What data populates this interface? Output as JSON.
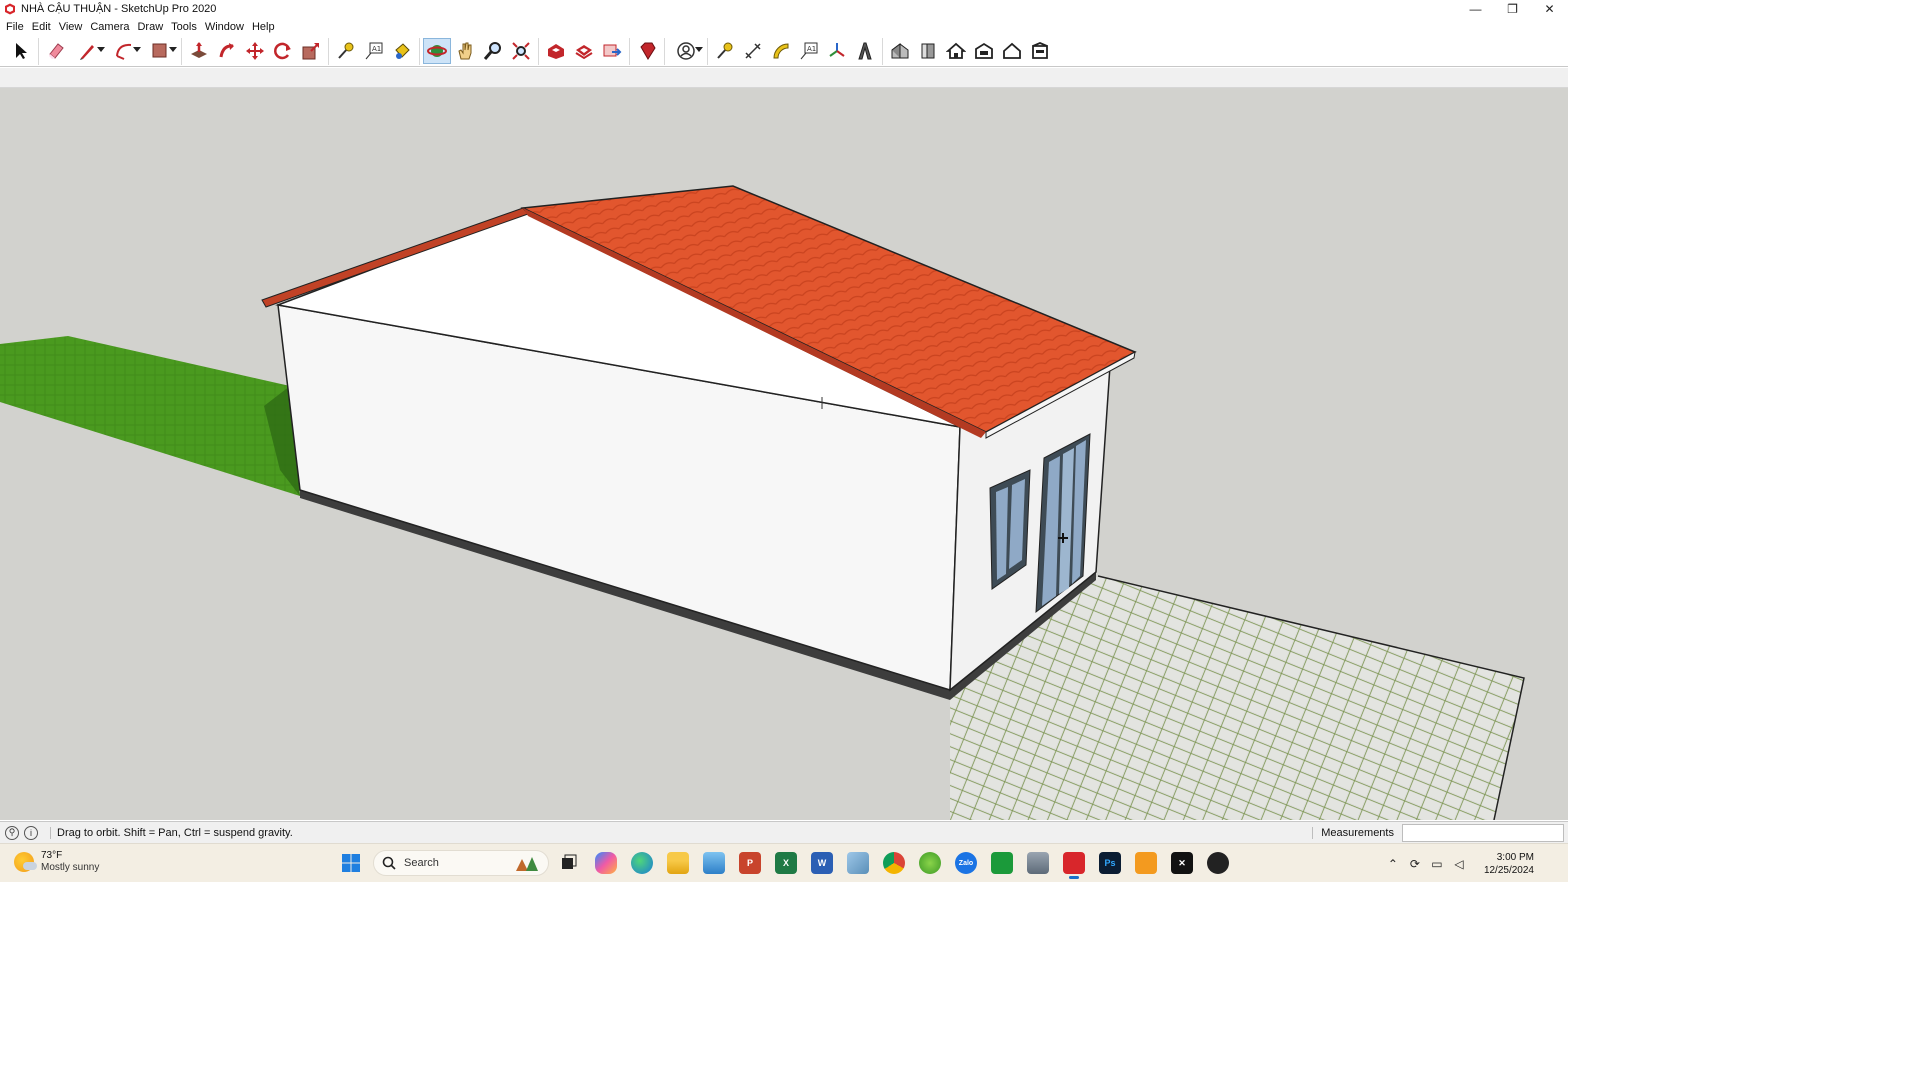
{
  "window": {
    "title": "NHÀ CẬU THUẬN - SketchUp Pro 2020",
    "minimize_glyph": "—",
    "restore_glyph": "❐",
    "close_glyph": "✕"
  },
  "menu": {
    "items": [
      "File",
      "Edit",
      "View",
      "Camera",
      "Draw",
      "Tools",
      "Window",
      "Help"
    ]
  },
  "toolbar": {
    "groups": [
      [
        "select-tool"
      ],
      [
        "eraser-tool",
        "pencil-line-tool",
        "arc-tool",
        "rectangle-tool"
      ],
      [
        "push-pull-tool",
        "follow-me-tool",
        "move-tool",
        "rotate-tool",
        "scale-tool"
      ],
      [
        "tape-measure-tool",
        "text-tool",
        "paint-bucket-tool"
      ],
      [
        "orbit-tool",
        "pan-tool",
        "zoom-tool",
        "zoom-extents-tool"
      ],
      [
        "warehouse-tool",
        "extension-warehouse-tool",
        "layout-send-tool"
      ],
      [
        "ruby-console-tool"
      ],
      [
        "user-account-tool"
      ],
      [
        "tape-measure-2-tool",
        "dimension-tool",
        "protractor-tool",
        "text-2-tool",
        "axes-tool",
        "3d-text-tool"
      ],
      [
        "iso-view",
        "front-view",
        "top-view",
        "back-view",
        "right-view",
        "left-view"
      ]
    ],
    "active_tool": "orbit-tool"
  },
  "status": {
    "hint": "Drag to orbit. Shift = Pan, Ctrl = suspend gravity.",
    "measurements_label": "Measurements",
    "measurements_value": ""
  },
  "taskbar": {
    "weather_temp": "73°F",
    "weather_desc": "Mostly sunny",
    "search_placeholder": "Search",
    "clock_time": "3:00 PM",
    "clock_date": "12/25/2024",
    "app_labels": {
      "zalo": "Zalo",
      "photoshop": "Ps",
      "capcut": "✕"
    }
  },
  "colors": {
    "viewport_bg": "#d2d2ce",
    "roof": "#e2562e",
    "grass": "#4a9a1f",
    "wall": "#f7f7f7",
    "pavers": "#d7d8d4",
    "taskbar_bg": "#f3eee3",
    "accent": "#1a6fc9"
  }
}
